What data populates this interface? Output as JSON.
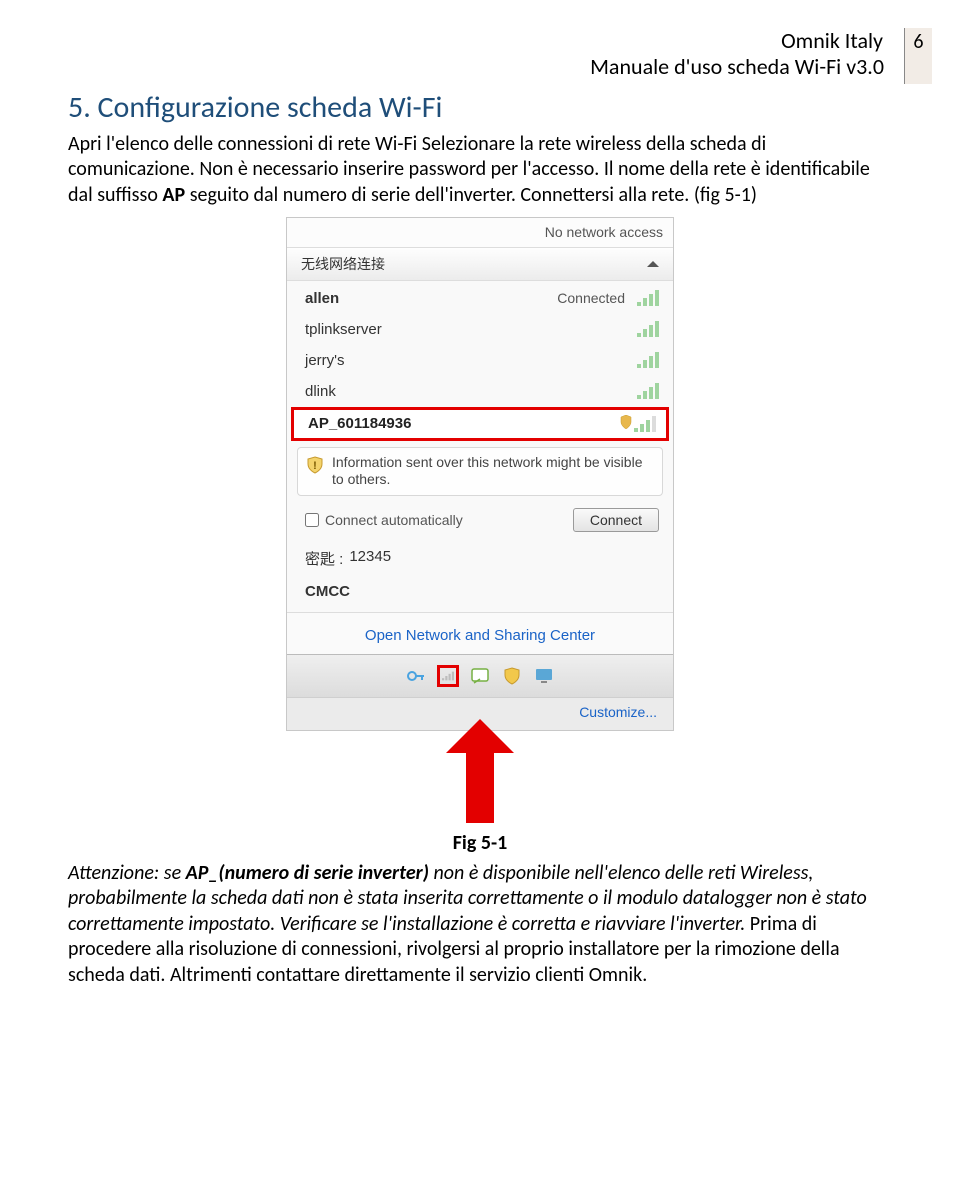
{
  "header": {
    "brand": "Omnik Italy",
    "subtitle": "Manuale d'uso scheda Wi-Fi v3.0",
    "page_number": "6"
  },
  "section": {
    "title": "5. Configurazione scheda Wi-Fi",
    "intro": "Apri l'elenco delle connessioni di rete Wi-Fi Selezionare la rete wireless della scheda di comunicazione. Non è necessario inserire password per l'accesso. Il nome della rete è identificabile dal suffisso ",
    "intro_bold": "AP",
    "intro_tail": " seguito dal numero di serie dell'inverter. Connettersi alla rete. (fig 5-1)"
  },
  "wifi_popup": {
    "top_status": "No network access",
    "section_head": "无线网络连接",
    "networks": [
      {
        "name": "allen",
        "status": "Connected",
        "bars": 4,
        "secure": false
      },
      {
        "name": "tplinkserver",
        "status": "",
        "bars": 4,
        "secure": false
      },
      {
        "name": "jerry's",
        "status": "",
        "bars": 4,
        "secure": false
      },
      {
        "name": "dlink",
        "status": "",
        "bars": 4,
        "secure": false
      }
    ],
    "highlight": {
      "name": "AP_601184936",
      "bars": 3,
      "secure": true
    },
    "warning_text": "Information sent over this network might be visible to others.",
    "auto_connect_label": "Connect automatically",
    "connect_label": "Connect",
    "key_label": "密匙 :",
    "key_value": "12345",
    "cmcc": "CMCC",
    "open_center": "Open Network and Sharing Center",
    "customize": "Customize..."
  },
  "figure_label": "Fig 5-1",
  "warning": {
    "lead": "Attenzione: se ",
    "bold": "AP_(numero di serie inverter)",
    "italic_tail": " non è disponibile nell'elenco delle reti Wireless, probabilmente la scheda dati non è stata inserita correttamente o il modulo datalogger non è stato correttamente impostato. Verificare se l'installazione è corretta e riavviare l'inverter. ",
    "roman_tail": "Prima di procedere alla risoluzione di connessioni, rivolgersi al proprio installatore per la rimozione della scheda dati. Altrimenti contattare direttamente il servizio clienti Omnik."
  }
}
